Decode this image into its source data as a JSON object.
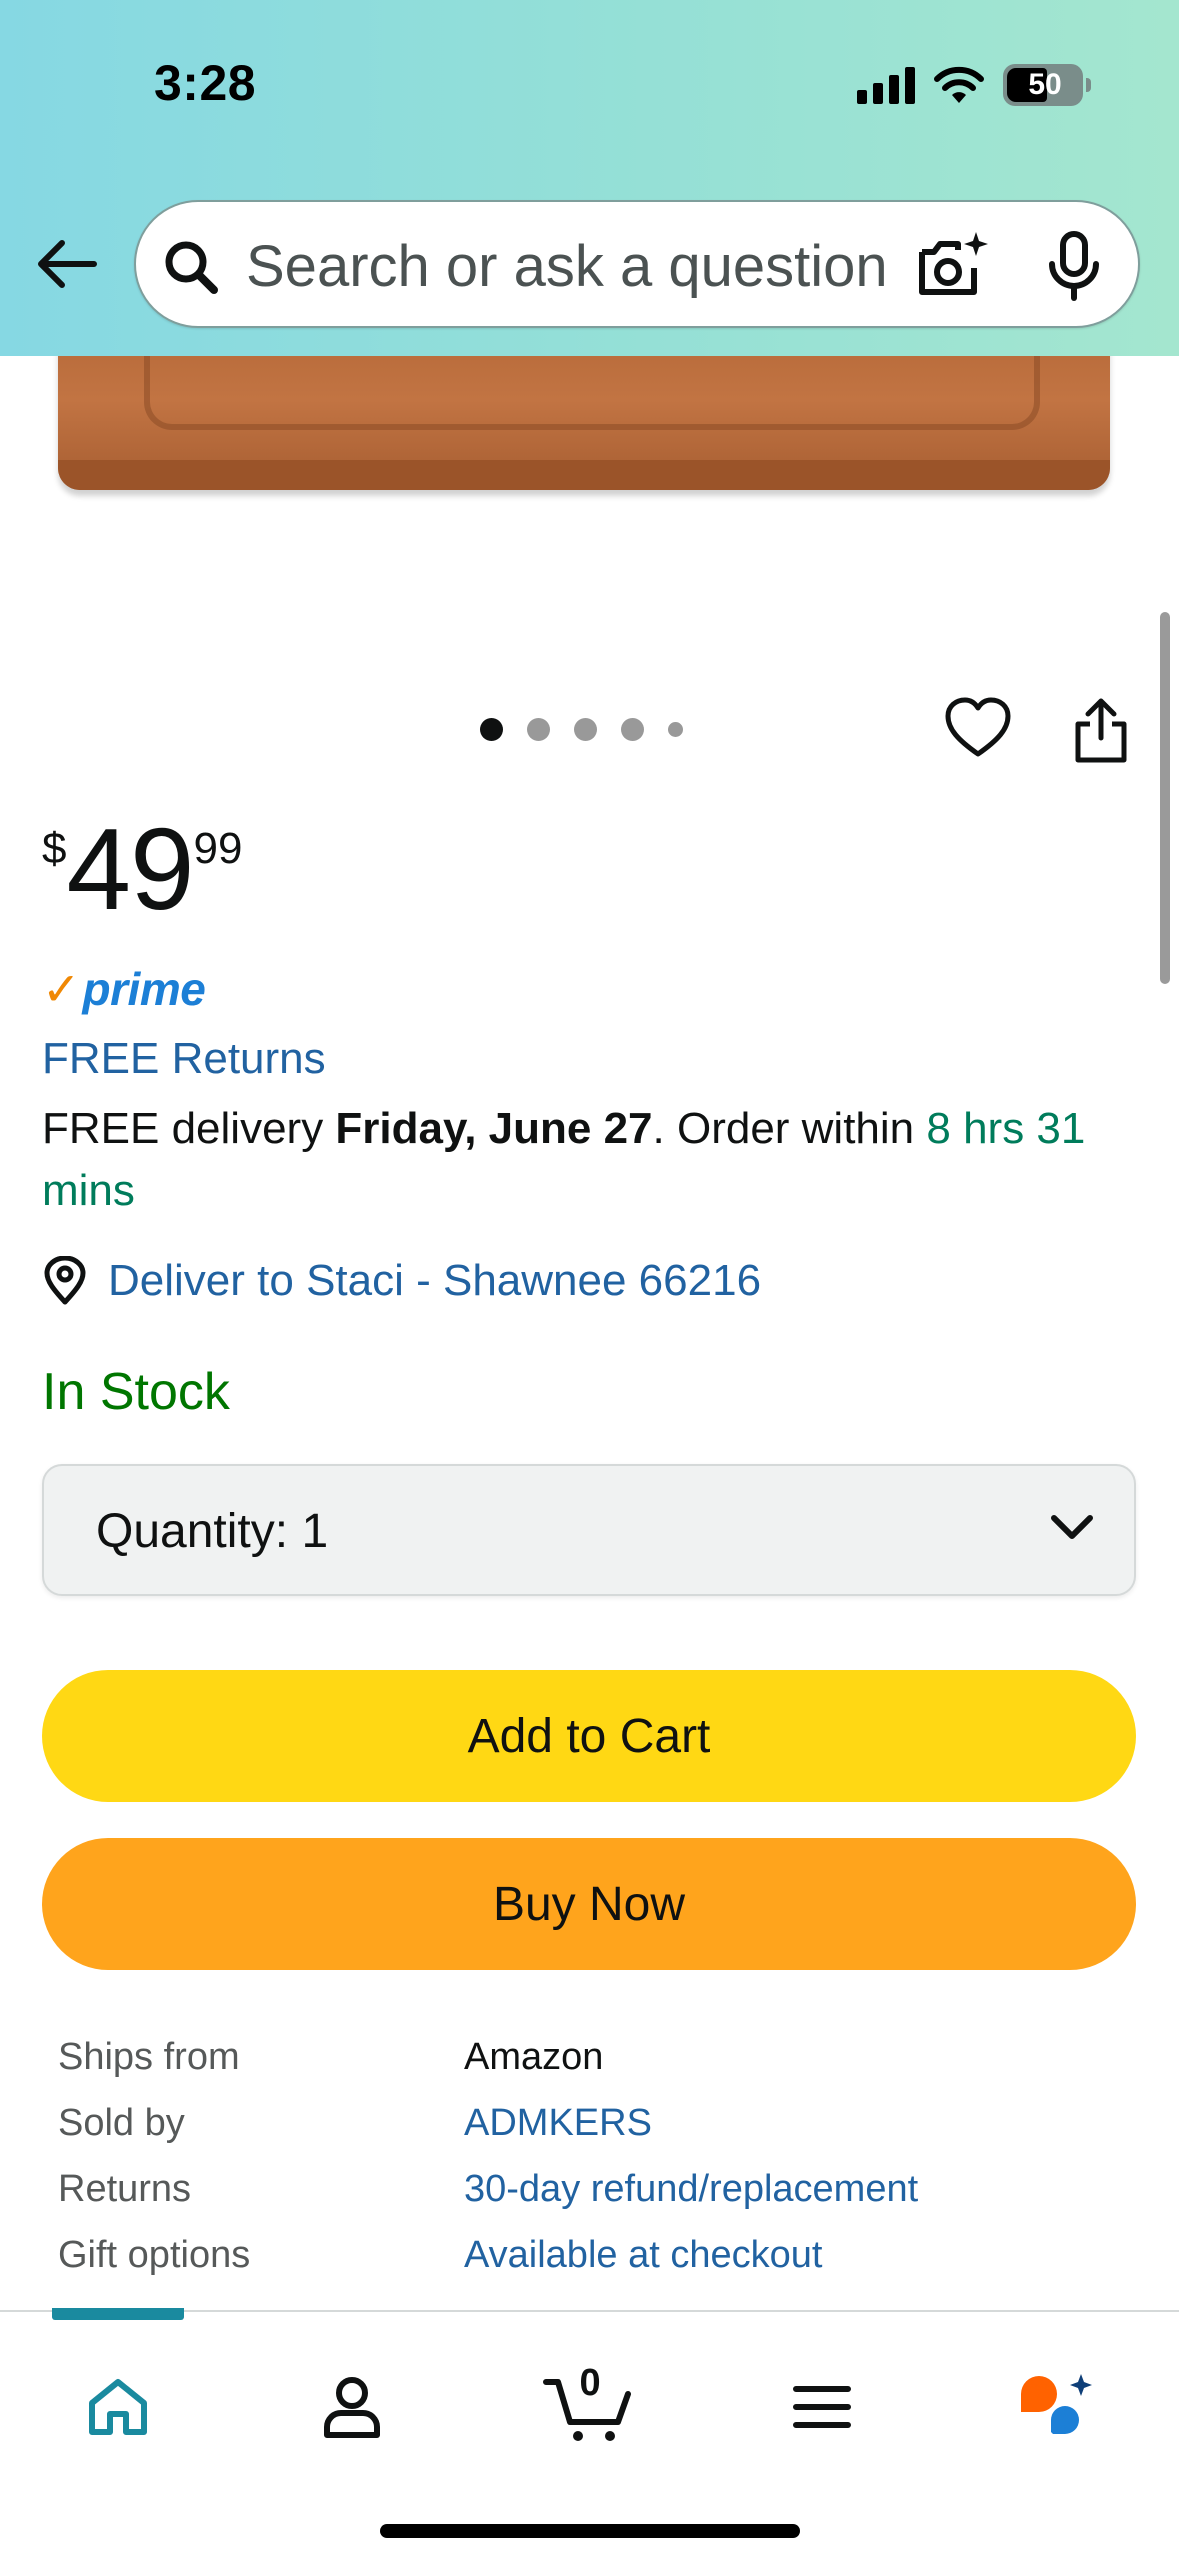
{
  "status_bar": {
    "time": "3:28",
    "battery": "50"
  },
  "search": {
    "placeholder": "Search or ask a question"
  },
  "gallery": {
    "total_images": 5,
    "active_index": 0
  },
  "product": {
    "price_symbol": "$",
    "price_whole": "49",
    "price_fraction": "99",
    "prime_label": "prime",
    "free_returns": "FREE Returns",
    "delivery_prefix": "FREE delivery ",
    "delivery_date": "Friday, June 27",
    "delivery_mid": ". Order within ",
    "delivery_countdown": "8 hrs 31 mins",
    "deliver_to": "Deliver to Staci - Shawnee 66216",
    "stock_status": "In Stock",
    "quantity_label": "Quantity:",
    "quantity_value": "1",
    "add_to_cart": "Add to Cart",
    "buy_now": "Buy Now"
  },
  "details": [
    {
      "label": "Ships from",
      "value": "Amazon"
    },
    {
      "label": "Sold by",
      "value": "ADMKERS"
    },
    {
      "label": "Returns",
      "value": "30-day refund/replacement"
    },
    {
      "label": "Gift options",
      "value": "Available at checkout"
    }
  ],
  "bottom_nav": {
    "cart_count": "0",
    "items": [
      "home-icon",
      "account-icon",
      "cart-icon",
      "menu-icon",
      "rufus-icon"
    ]
  },
  "colors": {
    "header_gradient_start": "#86d8e3",
    "header_gradient_end": "#a4e6cf",
    "link": "#2162a1",
    "in_stock": "#007600",
    "countdown": "#007c5b",
    "add_to_cart": "#ffd814",
    "buy_now": "#ffa41c",
    "prime_blue": "#1c7fd6",
    "prime_check": "#f08804",
    "nav_active": "#1a8a9f"
  }
}
